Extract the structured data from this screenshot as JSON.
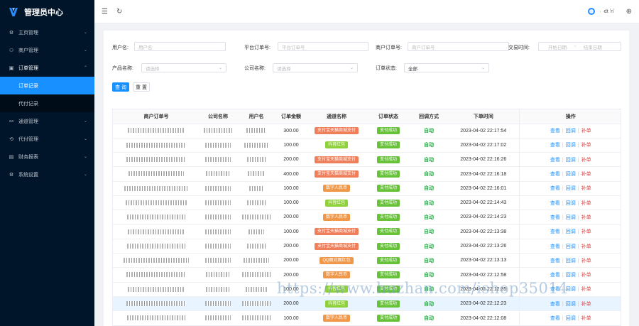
{
  "app": {
    "title": "管理员中心"
  },
  "sidebar": {
    "items": [
      {
        "label": "主页管理",
        "icon": "gear-icon"
      },
      {
        "label": "商户管理",
        "icon": "users-icon"
      },
      {
        "label": "订单管理",
        "icon": "calendar-icon",
        "open": true,
        "children": [
          {
            "label": "订单记录",
            "active": true
          },
          {
            "label": "代付记录"
          }
        ]
      },
      {
        "label": "通道管理",
        "icon": "network-icon"
      },
      {
        "label": "代付管理",
        "icon": "refresh-icon"
      },
      {
        "label": "财务报表",
        "icon": "document-icon"
      },
      {
        "label": "系统设置",
        "icon": "settings-icon"
      }
    ]
  },
  "header": {
    "user": "· ·dt ʼnʼ"
  },
  "filters": {
    "username_label": "用户名:",
    "username_placeholder": "用户名",
    "platform_order_label": "平台订单号:",
    "platform_order_placeholder": "平台订单号",
    "merchant_order_label": "商户订单号:",
    "merchant_order_placeholder": "商户订单号",
    "trade_time_label": "交易时间:",
    "start_placeholder": "开始日期",
    "range_sep": "~",
    "end_placeholder": "结束日期",
    "product_label": "产品名称:",
    "product_placeholder": "请选择",
    "company_label": "公司名称:",
    "company_placeholder": "请选择",
    "status_label": "订单状态:",
    "status_value": "全部",
    "search_button": "查 询",
    "reset_button": "重 置"
  },
  "table": {
    "headers": [
      "商户订单号",
      "公司名称",
      "用户名",
      "订单金额",
      "通道名称",
      "订单状态",
      "回调方式",
      "下单时间",
      "操作"
    ],
    "ops": {
      "view": "查看",
      "callback": "回调",
      "fix": "补单"
    },
    "status_label": "支付成功",
    "callback_label": "自动",
    "colors": {
      "orange": "#f0984a",
      "redorange": "#ef7e5a",
      "green": "#67c23a",
      "lime": "#9acd32",
      "blue": "#1890ff"
    },
    "rows": [
      {
        "amount": "300.00",
        "channel": "支付宝天猫商城支付",
        "channel_color": "#ef7e5a",
        "time": "2023-04-02 22:17:54"
      },
      {
        "amount": "100.00",
        "channel": "抖音红包",
        "channel_color": "#8fd13a",
        "time": "2023-04-02 22:17:02"
      },
      {
        "amount": "200.00",
        "channel": "支付宝天猫商城支付",
        "channel_color": "#ef7e5a",
        "time": "2023-04-02 22:16:26"
      },
      {
        "amount": "400.00",
        "channel": "支付宝天猫商城支付",
        "channel_color": "#ef7e5a",
        "time": "2023-04-02 22:16:18"
      },
      {
        "amount": "100.00",
        "channel": "数字人民币",
        "channel_color": "#f0984a",
        "time": "2023-04-02 22:16:01"
      },
      {
        "amount": "100.00",
        "channel": "抖音红包",
        "channel_color": "#8fd13a",
        "time": "2023-04-02 22:14:43"
      },
      {
        "amount": "200.00",
        "channel": "数字人民币",
        "channel_color": "#f0984a",
        "time": "2023-04-02 22:14:23"
      },
      {
        "amount": "100.00",
        "channel": "支付宝天猫商城支付",
        "channel_color": "#ef7e5a",
        "time": "2023-04-02 22:13:38"
      },
      {
        "amount": "200.00",
        "channel": "支付宝天猫商城支付",
        "channel_color": "#ef7e5a",
        "time": "2023-04-02 22:13:26"
      },
      {
        "amount": "200.00",
        "channel": "QQ面对面红包",
        "channel_color": "#f0984a",
        "time": "2023-04-02 22:13:13"
      },
      {
        "amount": "200.00",
        "channel": "数字人民币",
        "channel_color": "#f0984a",
        "time": "2023-04-02 22:12:58"
      },
      {
        "amount": "100.00",
        "channel": "抖音红包",
        "channel_color": "#8fd13a",
        "time": "2023-04-02 22:12:35"
      },
      {
        "amount": "200.00",
        "channel": "抖音红包",
        "channel_color": "#8fd13a",
        "time": "2023-04-02 22:12:23",
        "highlight": true
      },
      {
        "amount": "100.00",
        "channel": "数字人民币",
        "channel_color": "#f0984a",
        "time": "2023-04-02 22:12:08"
      }
    ]
  },
  "watermark": "https://www.huzhan.com/ishop35014"
}
